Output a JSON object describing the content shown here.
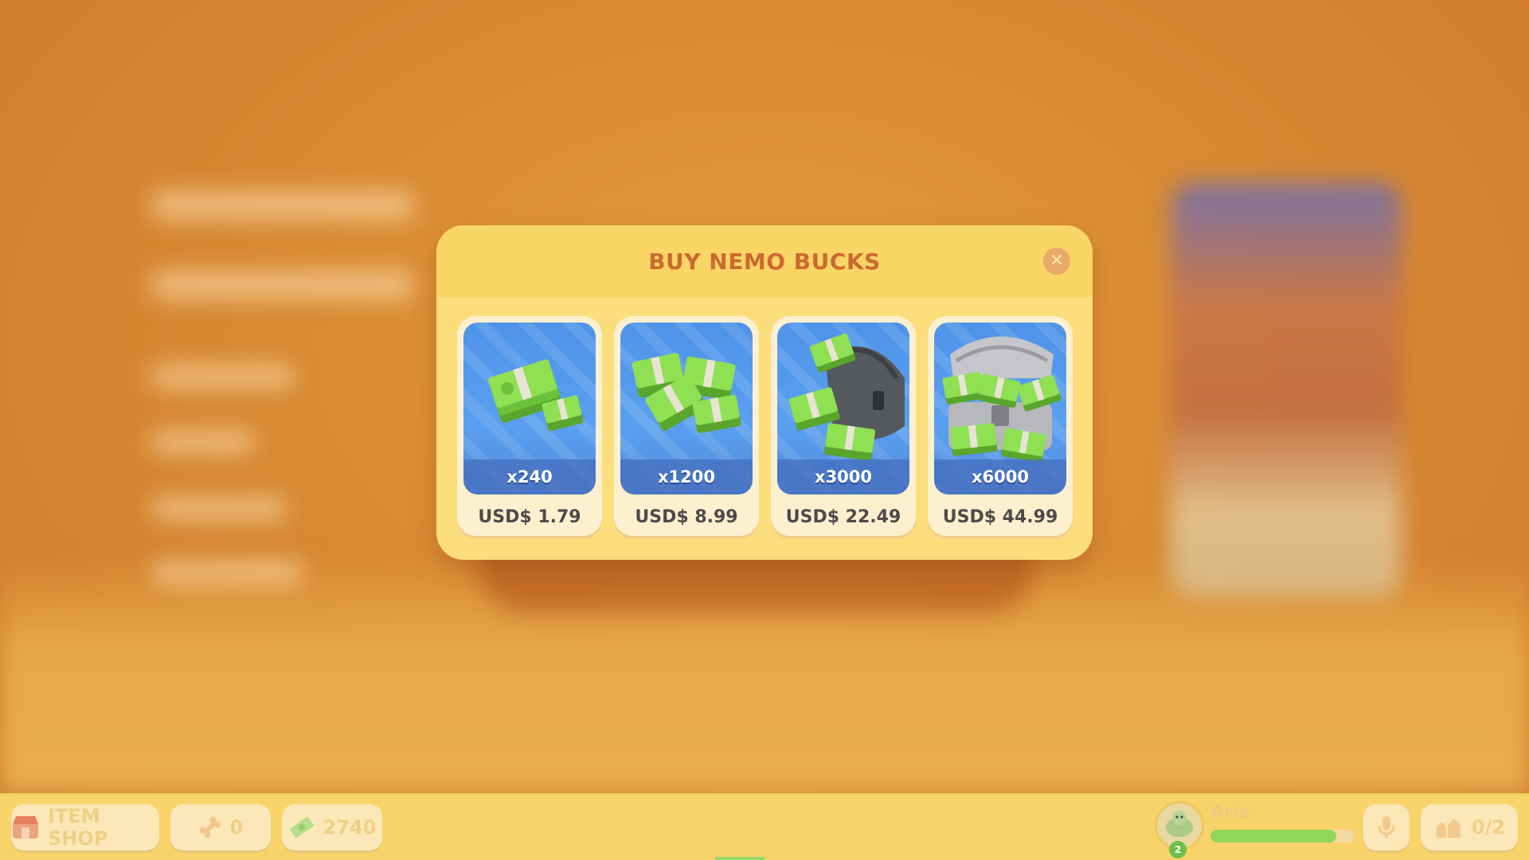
{
  "modal": {
    "title": "BUY NEMO BUCKS",
    "close_icon": "close-icon",
    "offers": [
      {
        "quantity": "x240",
        "price": "USD$ 1.79",
        "art": "small-cash-stack"
      },
      {
        "quantity": "x1200",
        "price": "USD$ 8.99",
        "art": "pile-of-cash"
      },
      {
        "quantity": "x3000",
        "price": "USD$ 22.49",
        "art": "bag-of-cash"
      },
      {
        "quantity": "x6000",
        "price": "USD$ 44.99",
        "art": "chest-of-cash"
      }
    ]
  },
  "bottom_bar": {
    "item_shop_label": "ITEM SHOP",
    "bones_count": "0",
    "bucks_count": "2740",
    "player_name": "Aria",
    "player_level": "2",
    "xp_fraction": 0.88,
    "party_count": "0/2"
  },
  "colors": {
    "modal_bg": "#fbdd7c",
    "title": "#cc6a2e",
    "card_bg": "#fdf0cf",
    "art_bg": "#4e93e8",
    "cash_green": "#7bd23f",
    "xp_green": "#8fd65a"
  }
}
